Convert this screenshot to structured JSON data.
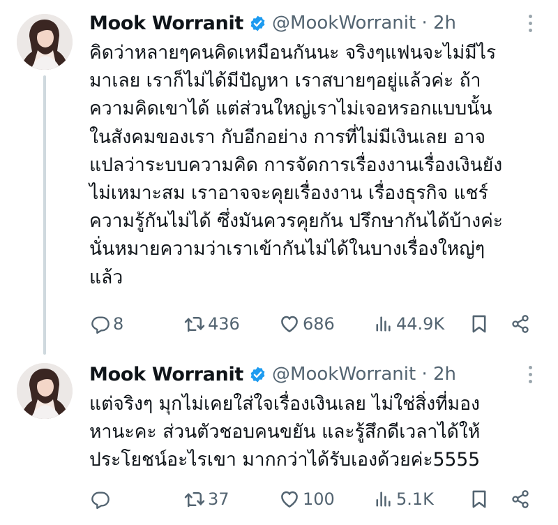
{
  "tweets": [
    {
      "author_name": "Mook Worranit",
      "handle_time": "@MookWorranit · 2h",
      "text": "คิดว่าหลายๆคนคิดเหมือนกันนะ จริงๆแฟนจะไม่มีไร\nมาเลย เราก็ไม่ได้มีปัญหา เราสบายๆอยู่แล้วค่ะ ถ้า\nความคิดเขาได้ แต่ส่วนใหญ่เราไม่เจอหรอกแบบนั้น\nในสังคมของเรา กับอีกอย่าง การที่ไม่มีเงินเลย อาจ\nแปลว่าระบบความคิด การจัดการเรื่องงานเรื่องเงินยัง\nไม่เหมาะสม เราอาจจะคุยเรื่องงาน เรื่องธุรกิจ แชร์\nความรู้กันไม่ได้ ซึ่งมันควรคุยกัน ปรึกษากันได้บ้างค่ะ\nนั่นหมายความว่าเราเข้ากันไม่ได้ในบางเรื่องใหญ่ๆ\nแล้ว",
      "replies": "8",
      "retweets": "436",
      "likes": "686",
      "views": "44.9K"
    },
    {
      "author_name": "Mook Worranit",
      "handle_time": "@MookWorranit · 2h",
      "text": "แต่จริงๆ มุกไม่เคยใส่ใจเรื่องเงินเลย ไม่ใช่สิ่งที่มอง\nหานะคะ ส่วนตัวชอบคนขยัน และรู้สึกดีเวลาได้ให้\nประโยชน์อะไรเขา มากกว่าได้รับเองด้วยค่ะ5555",
      "replies": "",
      "retweets": "37",
      "likes": "100",
      "views": "5.1K"
    }
  ],
  "colors": {
    "verified": "#1d9bf0",
    "muted": "#536471",
    "thread_line": "#cfd9de"
  },
  "icons": [
    "avatar",
    "verified-badge-icon",
    "more-icon",
    "reply-icon",
    "retweet-icon",
    "like-icon",
    "views-icon",
    "bookmark-icon",
    "share-icon"
  ]
}
